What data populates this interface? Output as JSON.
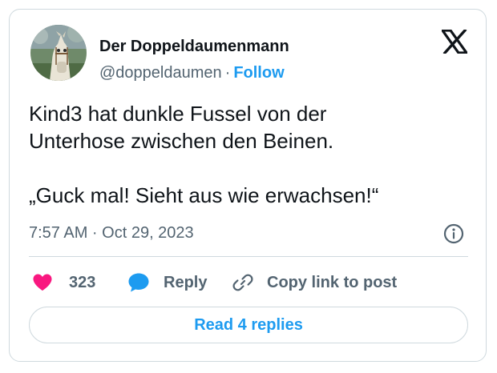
{
  "author": {
    "name": "Der Doppeldaumenmann",
    "handle": "@doppeldaumen",
    "separator": "·",
    "follow_label": "Follow",
    "avatar_icon": "horse-avatar"
  },
  "tweet": {
    "paragraph_1_line_1": "Kind3 hat dunkle Fussel von der",
    "paragraph_1_line_2": "Unterhose zwischen den Beinen.",
    "paragraph_2": "„Guck mal! Sieht aus wie erwachsen!“",
    "timestamp": "7:57 AM · Oct 29, 2023"
  },
  "actions": {
    "like_count": "323",
    "reply_label": "Reply",
    "copy_label": "Copy link to post"
  },
  "footer": {
    "read_replies_label": "Read 4 replies"
  },
  "icons": {
    "brand": "x-logo-icon",
    "info": "info-icon",
    "like": "heart-icon",
    "reply": "speech-bubble-icon",
    "copy": "link-icon"
  },
  "colors": {
    "accent": "#1d9bf0",
    "like": "#f91880",
    "text": "#0f1419",
    "muted": "#536471",
    "border": "#cfd9de"
  }
}
